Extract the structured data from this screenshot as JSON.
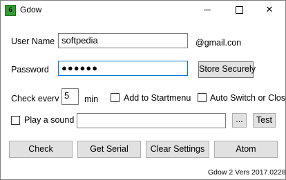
{
  "window": {
    "title": "Gdow",
    "icon_glyph": "G",
    "minimize_icon": "minimize-icon",
    "maximize_icon": "maximize-icon",
    "close_glyph": "✕"
  },
  "form": {
    "username_label": "User Name",
    "username_value": "softpedia",
    "domain_suffix": "@gmail.con",
    "password_label": "Password",
    "password_mask": "●●●●●●",
    "store_button": "Store Securely",
    "check_every_label": "Check everv",
    "check_every_value": "5",
    "min_label": "min",
    "add_startmenu_label": "Add to Startmenu",
    "auto_switch_label": "Auto Switch or Close",
    "play_sound_label": "Play a sound",
    "sound_path_value": "",
    "browse_button": "...",
    "test_button": "Test"
  },
  "actions": {
    "check": "Check",
    "get_serial": "Get Serial",
    "clear_settings": "Clear Settings",
    "atom": "Atom"
  },
  "footer": {
    "version": "Gdow 2 Vers 2017.0228"
  },
  "colors": {
    "accent": "#0078d7",
    "button_face": "#e1e1e1",
    "icon_green": "#2f9e2f"
  }
}
